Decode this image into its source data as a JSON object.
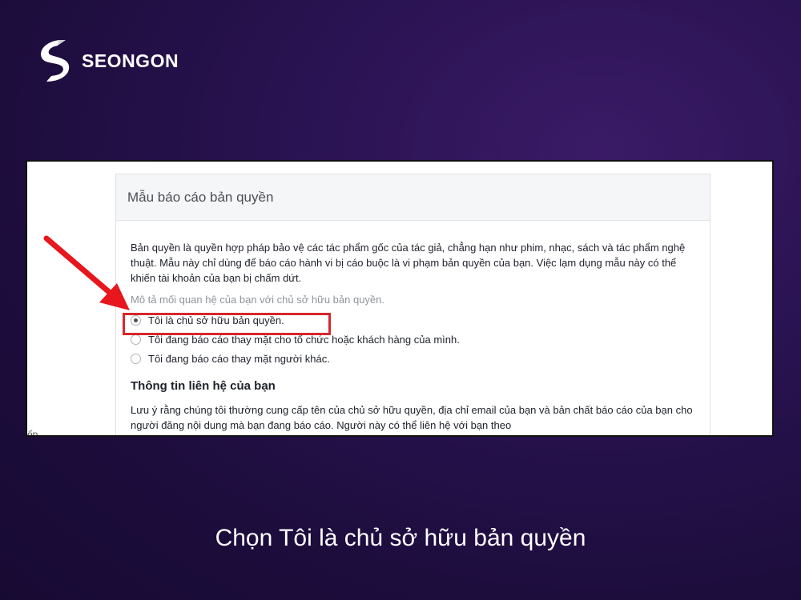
{
  "brand": {
    "name": "SEONGON",
    "logo_icon": "seongon-s-logo-icon"
  },
  "screenshot": {
    "panel_title": "Mẫu báo cáo bản quyền",
    "description": "Bản quyền là quyền hợp pháp bảo vệ các tác phẩm gốc của tác giả, chẳng hạn như phim, nhạc, sách và tác phẩm nghệ thuật. Mẫu này chỉ dùng để báo cáo hành vi bị cáo buộc là vi phạm bản quyền của bạn. Việc lạm dụng mẫu này có thể khiến tài khoản của bạn bị chấm dứt.",
    "question": "Mô tả mối quan hệ của bạn với chủ sở hữu bản quyền.",
    "options": [
      {
        "label": "Tôi là chủ sở hữu bản quyền.",
        "selected": true
      },
      {
        "label": "Tôi đang báo cáo thay mặt cho tổ chức hoặc khách hàng của mình.",
        "selected": false
      },
      {
        "label": "Tôi đang báo cáo thay mặt người khác.",
        "selected": false
      }
    ],
    "section_title": "Thông tin liên hệ của bạn",
    "note": "Lưu ý rằng chúng tôi thường cung cấp tên của chủ sở hữu quyền, địa chỉ email của bạn và bản chất báo cáo của bạn cho người đăng nội dung mà bạn đang báo cáo. Người này có thể liên hệ với bạn theo",
    "cut_text": "ốp",
    "highlight_color": "#d9262c",
    "arrow_color": "#e8161d"
  },
  "caption": "Chọn Tôi là chủ sở hữu bản quyền"
}
